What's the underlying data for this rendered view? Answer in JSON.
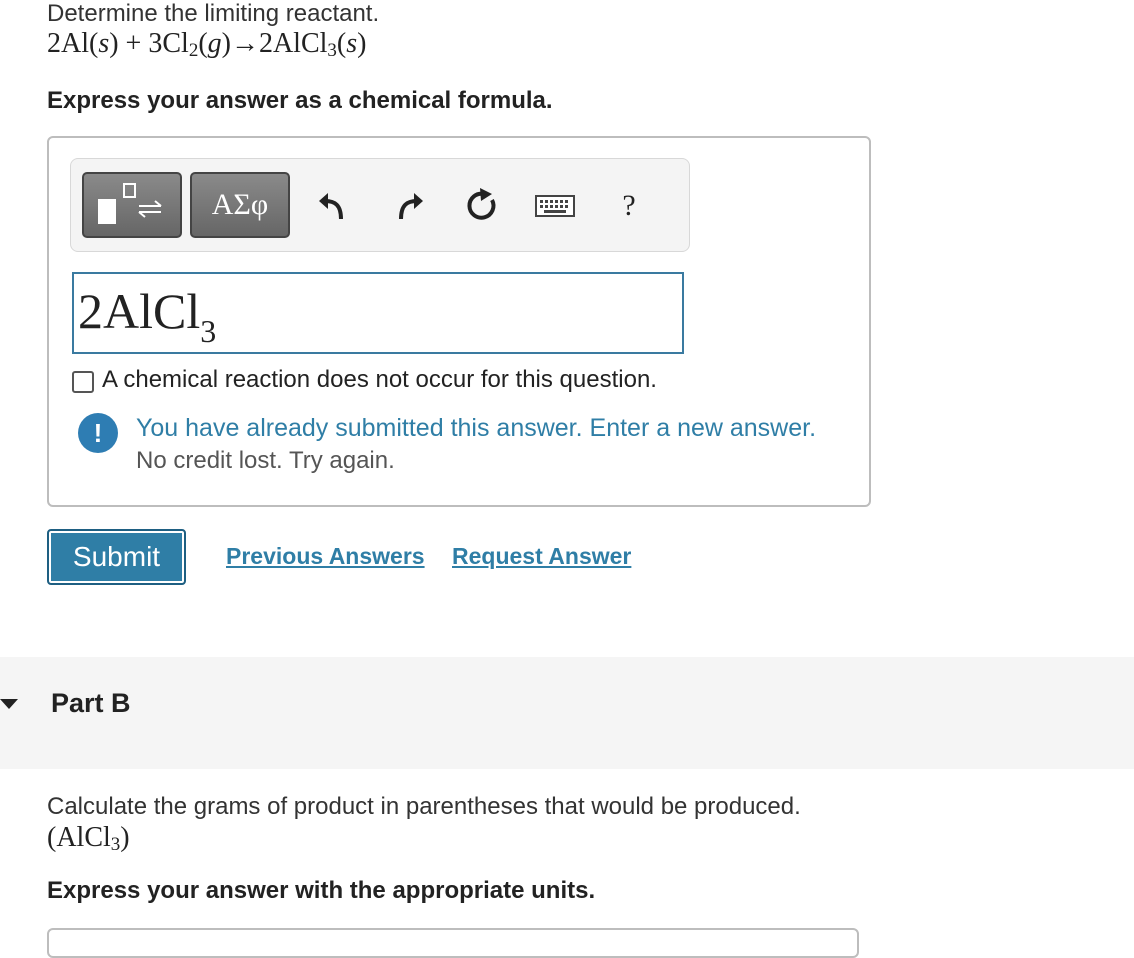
{
  "partA": {
    "question": "Determine the limiting reactant.",
    "equation": {
      "t1": "2Al(",
      "s1": "s",
      "t2": ") + 3Cl",
      "sub1": "2",
      "t3": "(",
      "g1": "g",
      "t4": ")→2AlCl",
      "sub2": "3",
      "t5": "(",
      "s2": "s",
      "t6": ")"
    },
    "instruction": "Express your answer as a chemical formula.",
    "toolbar": {
      "greek_label": "ΑΣφ",
      "help_label": "?"
    },
    "answer_value": {
      "main": "2AlCl",
      "sub": "3"
    },
    "checkbox_label": "A chemical reaction does not occur for this question.",
    "feedback": {
      "icon_text": "!",
      "message": "You have already submitted this answer. Enter a new answer.",
      "note": "No credit lost. Try again."
    },
    "submit_label": "Submit",
    "previous_answers_label": "Previous Answers",
    "request_answer_label": "Request Answer"
  },
  "partB": {
    "title": "Part B",
    "question": "Calculate the grams of product in parentheses that would be produced.",
    "formula": {
      "t1": "(AlCl",
      "sub": "3",
      "t2": ")"
    },
    "instruction": "Express your answer with the appropriate units."
  },
  "icons": [
    "template-icon",
    "undo-icon",
    "redo-icon",
    "reset-icon",
    "keyboard-icon",
    "help-icon",
    "feedback-info-icon",
    "collapse-arrow-icon"
  ],
  "colors": {
    "accent": "#2f7ea6",
    "toolbar_button": "#777777",
    "band": "#f5f5f5"
  }
}
